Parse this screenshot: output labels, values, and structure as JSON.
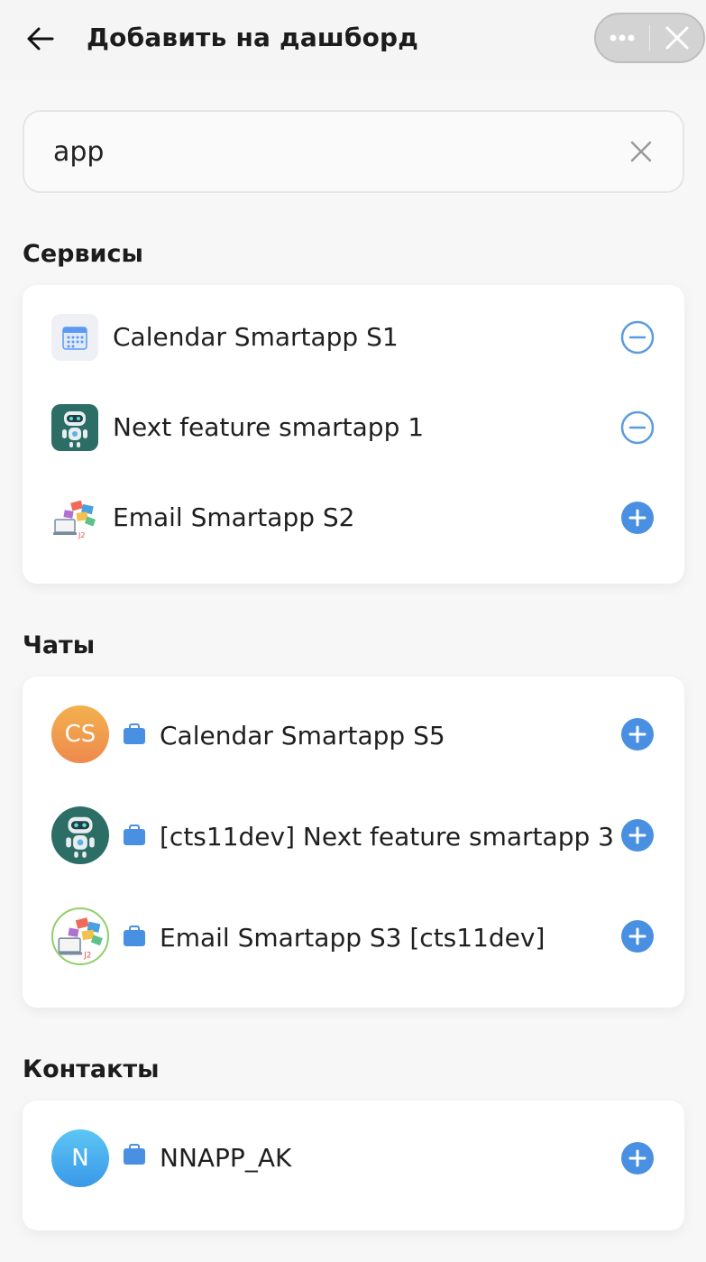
{
  "header": {
    "title": "Добавить на дашборд"
  },
  "search": {
    "value": "app"
  },
  "services": {
    "title": "Сервисы",
    "items": [
      {
        "label": "Calendar Smartapp S1",
        "icon": "calendar-icon",
        "action": "remove"
      },
      {
        "label": "Next feature smartapp 1",
        "icon": "robot-icon",
        "action": "remove"
      },
      {
        "label": "Email Smartapp S2",
        "icon": "email-illustration-icon",
        "action": "add"
      }
    ]
  },
  "chats": {
    "title": "Чаты",
    "items": [
      {
        "label": "Calendar Smartapp S5",
        "avatar_text": "CS",
        "action": "add"
      },
      {
        "label": "[cts11dev] Next feature smartapp 3",
        "avatar": "robot-icon",
        "action": "add"
      },
      {
        "label": "Email Smartapp S3 [cts11dev]",
        "avatar": "email-illustration-icon",
        "action": "add"
      }
    ]
  },
  "contacts": {
    "title": "Контакты",
    "items": [
      {
        "label": "NNAPP_AK",
        "avatar_text": "N",
        "action": "add"
      }
    ]
  },
  "colors": {
    "accent": "#4a90e2",
    "remove_icon": "#5b9be0",
    "robot_bg": "#2c6e66",
    "cs_avatar": "#f0a04b",
    "n_avatar": "#4fb1ee"
  }
}
